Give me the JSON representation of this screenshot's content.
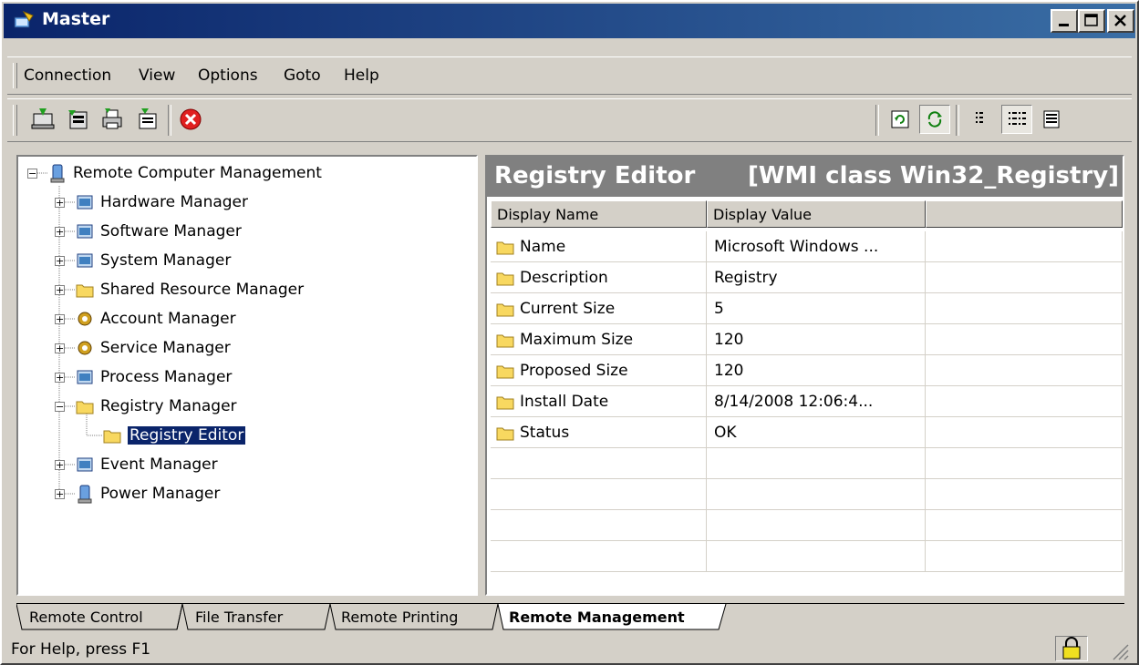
{
  "window": {
    "title": "Master"
  },
  "menu": [
    {
      "label": "Connection"
    },
    {
      "label": "View"
    },
    {
      "label": "Options"
    },
    {
      "label": "Goto"
    },
    {
      "label": "Help"
    }
  ],
  "toolbar": {
    "left_buttons": [
      "connect-icon",
      "disconnect-icon",
      "print-icon",
      "properties-icon",
      "stop-icon"
    ],
    "right_buttons": [
      "refresh-icon",
      "auto-refresh-icon",
      "list-view-icon",
      "details-view-icon",
      "report-view-icon"
    ]
  },
  "tree": {
    "root": "Remote Computer Management",
    "items": [
      {
        "label": "Hardware Manager",
        "expander": "+"
      },
      {
        "label": "Software Manager",
        "expander": "+"
      },
      {
        "label": "System Manager",
        "expander": "+"
      },
      {
        "label": "Shared Resource Manager",
        "expander": "+"
      },
      {
        "label": "Account Manager",
        "expander": "+"
      },
      {
        "label": "Service Manager",
        "expander": "+"
      },
      {
        "label": "Process Manager",
        "expander": "+"
      },
      {
        "label": "Registry Manager",
        "expander": "-"
      },
      {
        "label": "Registry Editor",
        "expander": ""
      },
      {
        "label": "Event Manager",
        "expander": "+"
      },
      {
        "label": "Power Manager",
        "expander": "+"
      }
    ]
  },
  "panel": {
    "title": "Registry Editor",
    "subtitle": "[WMI class Win32_Registry]",
    "columns": [
      "Display Name",
      "Display Value"
    ],
    "rows": [
      {
        "name": "Name",
        "value": "Microsoft Windows ..."
      },
      {
        "name": "Description",
        "value": "Registry"
      },
      {
        "name": "Current Size",
        "value": "5"
      },
      {
        "name": "Maximum Size",
        "value": "120"
      },
      {
        "name": "Proposed Size",
        "value": "120"
      },
      {
        "name": "Install Date",
        "value": "8/14/2008 12:06:4..."
      },
      {
        "name": "Status",
        "value": "OK"
      }
    ]
  },
  "tabs": [
    "Remote Control",
    "File Transfer",
    "Remote Printing",
    "Remote Management"
  ],
  "status": {
    "text": "For Help, press F1"
  },
  "colors": {
    "titlebar": "#0a246a",
    "selection": "#0a246a",
    "face": "#d4d0c8"
  }
}
